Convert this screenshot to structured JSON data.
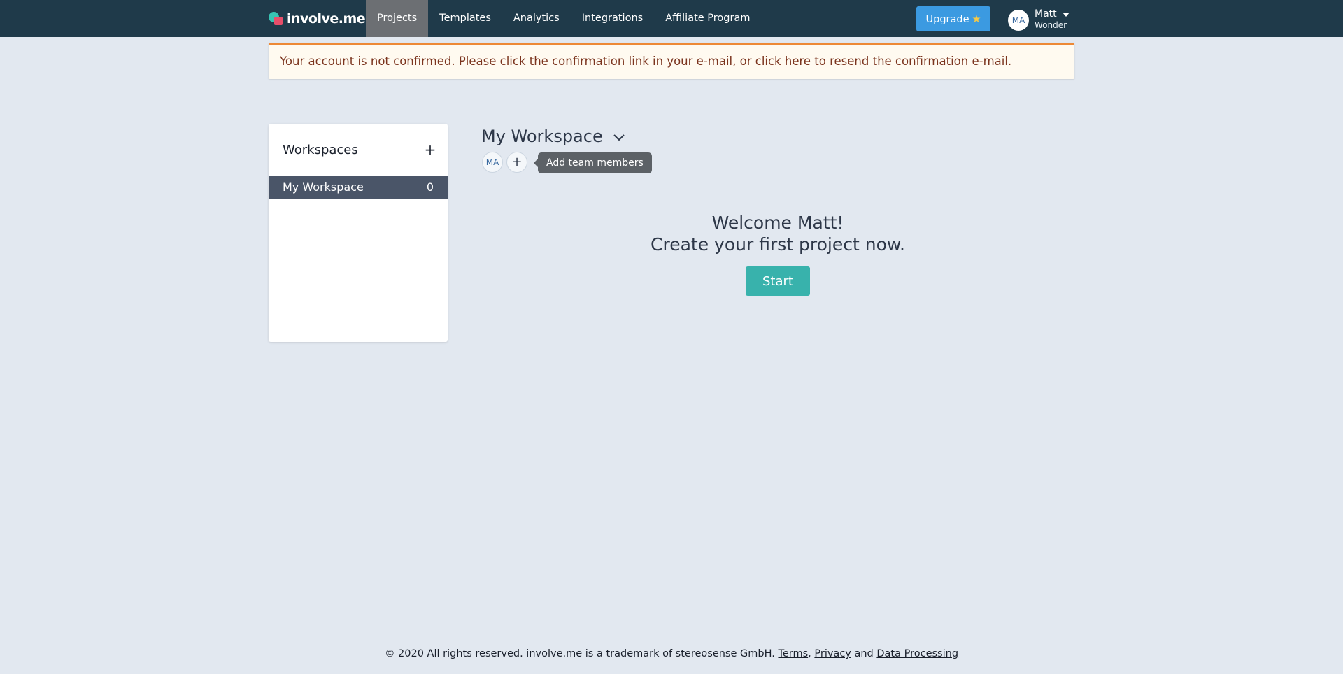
{
  "brand": {
    "name": "involve.me",
    "colors": {
      "nav_bg": "#1f3a4a",
      "accent": "#38b2ac",
      "upgrade": "#3b9ae1"
    }
  },
  "nav": {
    "links": [
      "Projects",
      "Templates",
      "Analytics",
      "Integrations",
      "Affiliate Program"
    ],
    "active": "Projects",
    "upgrade_label": "Upgrade",
    "upgrade_icon": "star-icon"
  },
  "user": {
    "initials": "MA",
    "first_name": "Matt",
    "last_name": "Wonder"
  },
  "alert": {
    "text_before": "Your account is not confirmed. Please click the confirmation link in your e-mail, or ",
    "link_text": "click here",
    "text_after": " to resend the confirmation e-mail."
  },
  "sidebar": {
    "title": "Workspaces",
    "add_icon": "plus-icon",
    "items": [
      {
        "label": "My Workspace",
        "count": "0"
      }
    ]
  },
  "workspace": {
    "title": "My Workspace",
    "member_initials": "MA",
    "add_member_tooltip": "Add team members"
  },
  "welcome": {
    "line1": "Welcome Matt!",
    "line2": "Create your first project now.",
    "start_label": "Start"
  },
  "footer": {
    "text": "© 2020 All rights reserved. involve.me is a trademark of stereosense GmbH. ",
    "terms": "Terms",
    "sep1": ", ",
    "privacy": "Privacy",
    "sep2": " and ",
    "data_processing": "Data Processing"
  }
}
